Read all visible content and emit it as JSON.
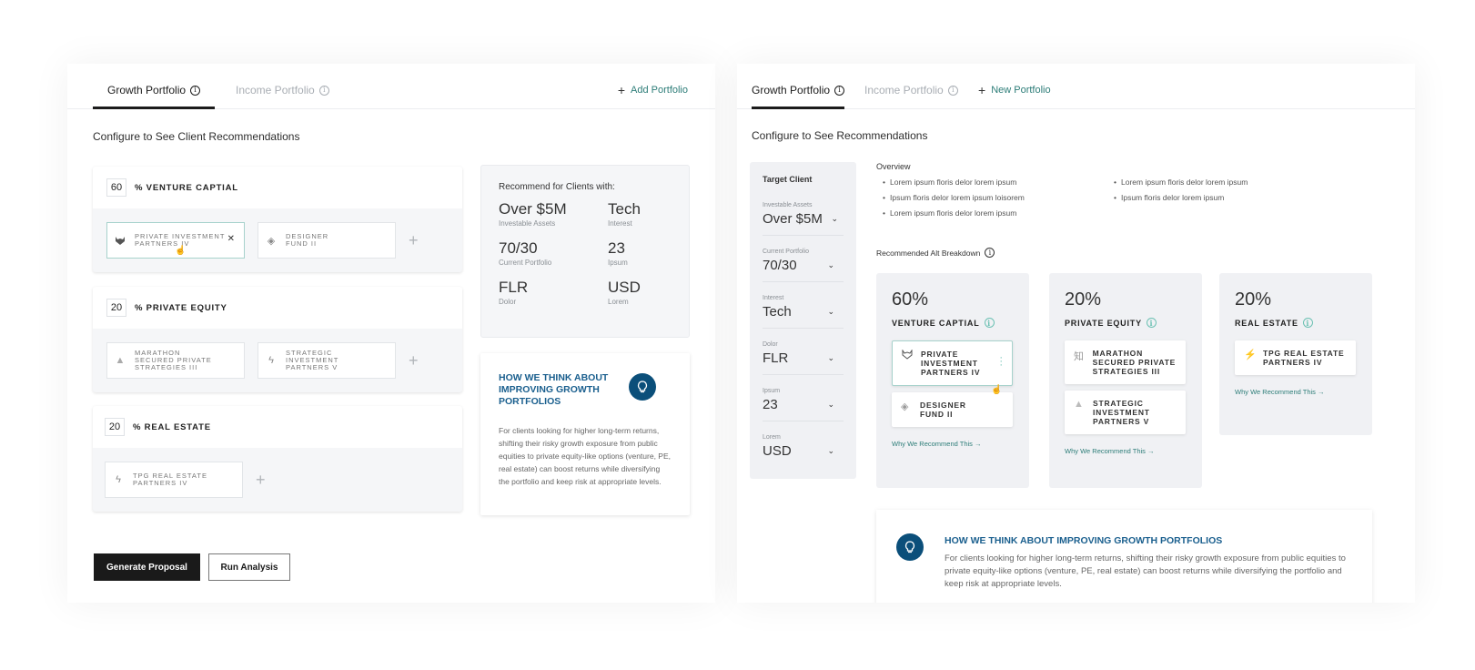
{
  "left": {
    "tabs": [
      {
        "label": "Growth Portfolio",
        "active": true
      },
      {
        "label": "Income Portfolio",
        "active": false
      }
    ],
    "add_portfolio": "Add Portfolio",
    "section_title": "Configure to See Client Recommendations",
    "groups": [
      {
        "percent": "60",
        "label": "% VENTURE CAPTIAL",
        "funds": [
          {
            "name": "PRIVATE INVESTMENT PARTNERS IV",
            "icon": "wolf-icon",
            "selected": true
          },
          {
            "name": "DESIGNER FUND II",
            "icon": "diamond-icon",
            "selected": false
          }
        ]
      },
      {
        "percent": "20",
        "label": "% PRIVATE EQUITY",
        "funds": [
          {
            "name": "MARATHON SECURED PRIVATE STRATEGIES III",
            "icon": "triangle-icon",
            "selected": false
          },
          {
            "name": "STRATEGIC INVESTMENT PARTNERS V",
            "icon": "bolt-icon",
            "selected": false
          }
        ]
      },
      {
        "percent": "20",
        "label": "% REAL ESTATE",
        "funds": [
          {
            "name": "TPG REAL ESTATE PARTNERS IV",
            "icon": "bolt-icon",
            "selected": false
          }
        ]
      }
    ],
    "recommend": {
      "title": "Recommend for Clients with:",
      "items": [
        {
          "value": "Over $5M",
          "label": "Investable Assets"
        },
        {
          "value": "Tech",
          "label": "Interest"
        },
        {
          "value": "70/30",
          "label": "Current Portfolio"
        },
        {
          "value": "23",
          "label": "Ipsum"
        },
        {
          "value": "FLR",
          "label": "Dolor"
        },
        {
          "value": "USD",
          "label": "Lorem"
        }
      ]
    },
    "think": {
      "title": "HOW WE THINK ABOUT IMPROVING GROWTH PORTFOLIOS",
      "text": "For clients looking for higher long-term returns, shifting their risky growth exposure from public equities to private equity-like options (venture, PE, real estate) can boost returns while diversifying the portfolio and keep risk at appropriate levels."
    },
    "buttons": {
      "generate": "Generate Proposal",
      "run": "Run Analysis"
    }
  },
  "right": {
    "tabs": [
      {
        "label": "Growth Portfolio",
        "active": true
      },
      {
        "label": "Income Portfolio",
        "active": false
      }
    ],
    "new_portfolio": "New Portfolio",
    "section_title": "Configure to See Recommendations",
    "target": {
      "title": "Target Client",
      "selects": [
        {
          "label": "Investable Assets",
          "value": "Over $5M"
        },
        {
          "label": "Current Portfolio",
          "value": "70/30"
        },
        {
          "label": "Interest",
          "value": "Tech"
        },
        {
          "label": "Dolor",
          "value": "FLR"
        },
        {
          "label": "Ipsum",
          "value": "23"
        },
        {
          "label": "Lorem",
          "value": "USD"
        }
      ]
    },
    "overview": {
      "title": "Overview",
      "col1": [
        "Lorem ipsum floris delor lorem ipsum",
        "Ipsum floris delor lorem ipsum loisorem",
        "Lorem ipsum floris delor lorem ipsum"
      ],
      "col2": [
        "Lorem ipsum floris delor lorem ipsum",
        "Ipsum floris delor lorem ipsum"
      ]
    },
    "alt_title": "Recommended Alt Breakdown",
    "alts": [
      {
        "percent": "60%",
        "name": "VENTURE CAPTIAL",
        "funds": [
          {
            "name": "PRIVATE INVESTMENT PARTNERS IV",
            "icon": "wolf-icon",
            "selected": true
          },
          {
            "name": "DESIGNER FUND II",
            "icon": "diamond-icon",
            "selected": false
          }
        ],
        "link": "Why We Recommend This →"
      },
      {
        "percent": "20%",
        "name": "PRIVATE EQUITY",
        "funds": [
          {
            "name": "MARATHON SECURED PRIVATE STRATEGIES III",
            "icon": "kanji-icon",
            "selected": false
          },
          {
            "name": "STRATEGIC INVESTMENT PARTNERS V",
            "icon": "triangle-icon",
            "selected": false
          }
        ],
        "link": "Why We Recommend This →"
      },
      {
        "percent": "20%",
        "name": "REAL ESTATE",
        "funds": [
          {
            "name": "TPG REAL ESTATE PARTNERS IV",
            "icon": "bolt-icon",
            "selected": false
          }
        ],
        "link": "Why We Recommend This →"
      }
    ],
    "think": {
      "title": "HOW WE THINK ABOUT IMPROVING GROWTH PORTFOLIOS",
      "text": "For clients looking for higher long-term returns, shifting their risky growth exposure from public equities to private equity-like options (venture, PE, real estate) can boost returns while diversifying the portfolio and keep risk at appropriate levels."
    }
  }
}
